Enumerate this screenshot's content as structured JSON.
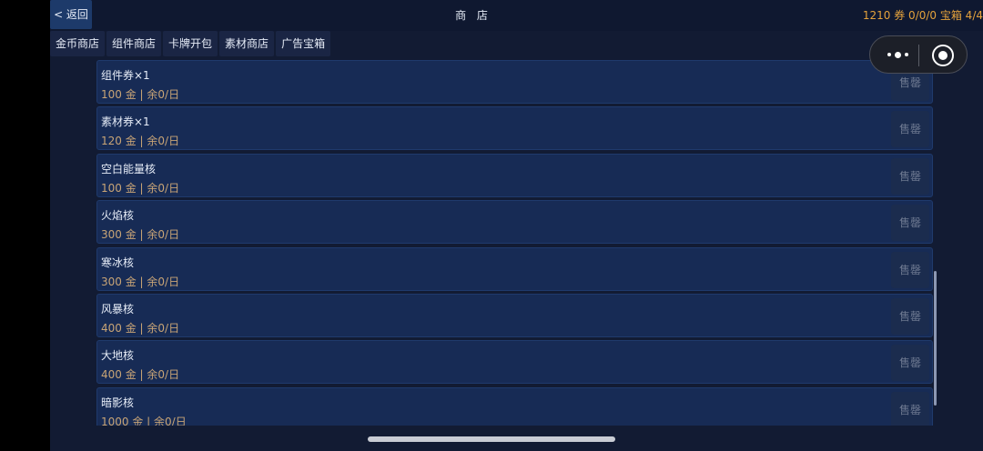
{
  "header": {
    "back_label": "< 返回",
    "title": "商 店",
    "stats": "1210 券 0/0/0 宝箱 4/4"
  },
  "tabs": [
    {
      "label": "金币商店"
    },
    {
      "label": "组件商店"
    },
    {
      "label": "卡牌开包"
    },
    {
      "label": "素材商店"
    },
    {
      "label": "广告宝箱"
    }
  ],
  "items": [
    {
      "name": "组件券×1",
      "price": "100 金 | 余0/日",
      "button": "售罄"
    },
    {
      "name": "素材券×1",
      "price": "120 金 | 余0/日",
      "button": "售罄"
    },
    {
      "name": "空白能量核",
      "price": "100 金 | 余0/日",
      "button": "售罄"
    },
    {
      "name": "火焰核",
      "price": "300 金 | 余0/日",
      "button": "售罄"
    },
    {
      "name": "寒冰核",
      "price": "300 金 | 余0/日",
      "button": "售罄"
    },
    {
      "name": "风暴核",
      "price": "400 金 | 余0/日",
      "button": "售罄"
    },
    {
      "name": "大地核",
      "price": "400 金 | 余0/日",
      "button": "售罄"
    },
    {
      "name": "暗影核",
      "price": "1000 金 | 余0/日",
      "button": "售罄"
    }
  ],
  "icons": {
    "capsule_more": "more-dots-icon",
    "capsule_close": "target-circle-icon"
  }
}
